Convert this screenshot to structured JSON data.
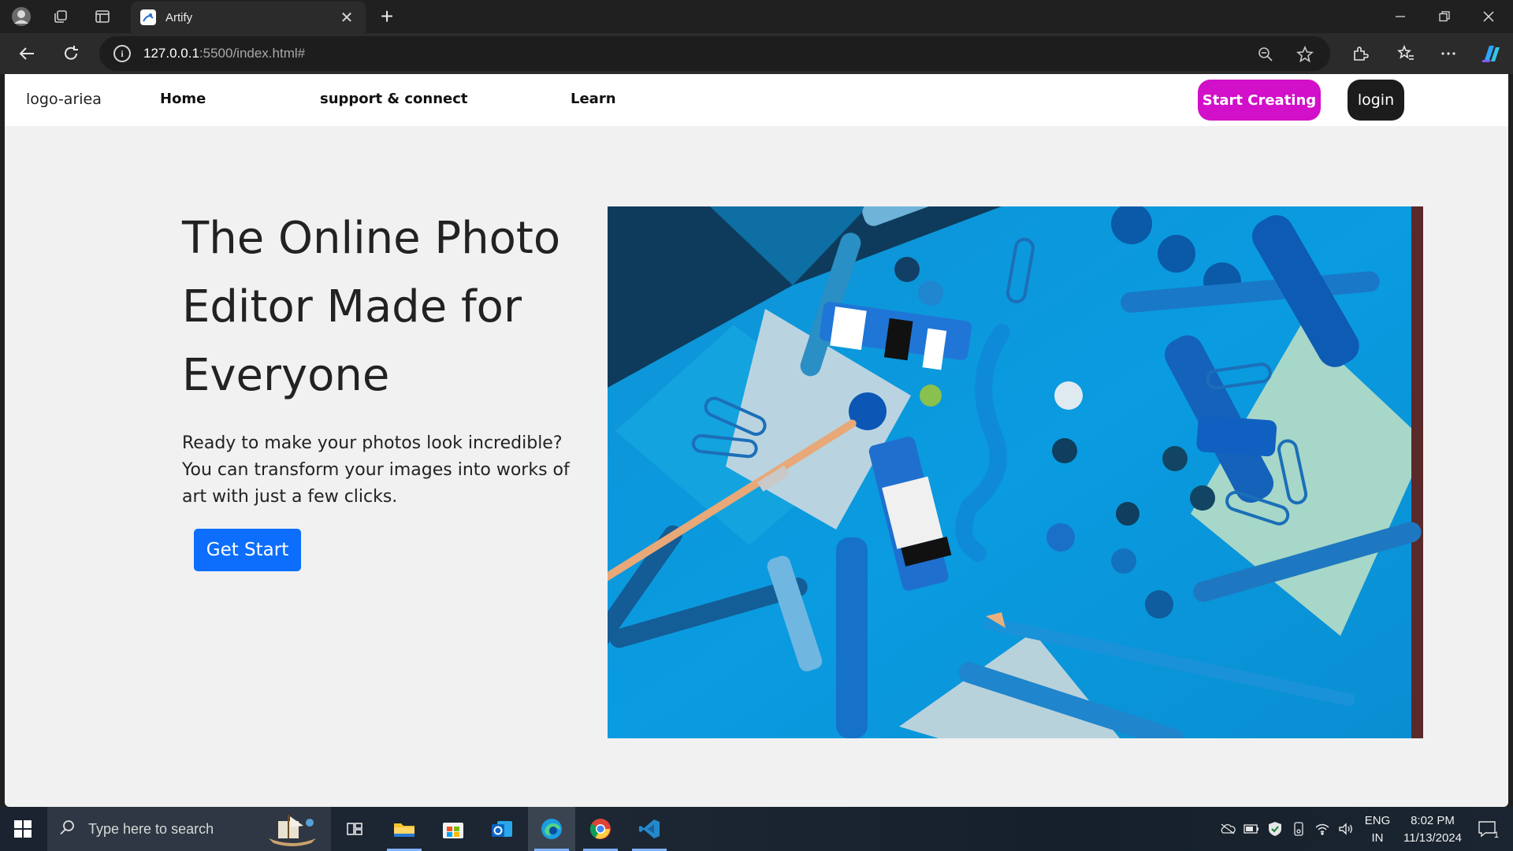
{
  "browser": {
    "tab_title": "Artify",
    "url_host": "127.0.0.1",
    "url_rest": ":5500/index.html#"
  },
  "site": {
    "logo": "logo-ariea",
    "nav": [
      {
        "label": "Home"
      },
      {
        "label": "support & connect"
      },
      {
        "label": "Learn"
      }
    ],
    "start_creating_label": "Start Creating",
    "login_label": "login",
    "colors": {
      "start_creating": "#d20fc9",
      "get_start": "#0d6efd",
      "login": "#1c1c1c"
    }
  },
  "hero": {
    "title_lines": [
      "The Online Photo",
      "Editor Made for",
      "Everyone"
    ],
    "text_lines": [
      "Ready to make your photos look incredible?",
      "You can transform your images into works of",
      "art with just a few clicks."
    ],
    "cta_label": "Get Start",
    "image": "blue art supplies flat lay (paint tubes, brush, paper clips, buttons, pencils)"
  },
  "taskbar": {
    "search_placeholder": "Type here to search",
    "language_top": "ENG",
    "language_bottom": "IN",
    "time": "8:02 PM",
    "date": "11/13/2024",
    "notification_count": "1",
    "apps": [
      "task-view",
      "file-explorer",
      "microsoft-store",
      "outlook",
      "edge",
      "chrome",
      "vscode"
    ]
  }
}
